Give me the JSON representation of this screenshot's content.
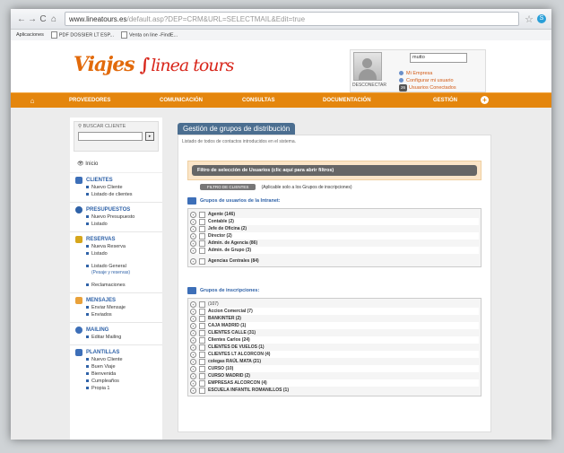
{
  "browser": {
    "url_main": "www.lineatours.es",
    "url_rest": "/default.asp?DEP=CRM&URL=SELECTMAIL&Edit=true",
    "bookmarks": [
      "Aplicaciones",
      "PDF DOSSIER LT ESP...",
      "Venta on line -FindE..."
    ]
  },
  "header": {
    "logo_first": "Viajes",
    "logo_second": "linea tours",
    "user_field": "mutto",
    "links": [
      "Mi Empresa",
      "Configurar mi usuario",
      "Usuarios Conectados"
    ],
    "connected_count": "26",
    "disconnect_label": "DESCONECTAR"
  },
  "menu": {
    "items": [
      "PROVEEDORES",
      "COMUNICACIÓN",
      "CONSULTAS",
      "DOCUMENTACIÓN",
      "GESTIÓN"
    ]
  },
  "sidebar": {
    "search_label": "BUSCAR CLIENTE",
    "inicio": "Inicio",
    "sections": [
      {
        "title": "CLIENTES",
        "color": "#3d6fb8",
        "items": [
          "Nuevo Cliente",
          "Listado de clientes"
        ]
      },
      {
        "title": "PRESUPUESTOS",
        "color": "#2f62a8",
        "items": [
          "Nuevo Presupuesto",
          "Listado"
        ]
      },
      {
        "title": "RESERVAS",
        "color": "#d6a61c",
        "items": [
          "Nueva Reserva",
          "Listado",
          "Listado General"
        ],
        "sub": "(Pesaje y reservas)",
        "extra": "Reclamaciones"
      },
      {
        "title": "MENSAJES",
        "color": "#e9a13a",
        "items": [
          "Enviar Mensaje",
          "Enviados"
        ]
      },
      {
        "title": "MAILING",
        "color": "#3d6fb8",
        "items": [
          "Editar Mailing"
        ]
      },
      {
        "title": "PLANTILLAS",
        "color": "#3d6fb8",
        "items": [
          "Nuevo Cliente",
          "Buen Viaje",
          "Bienvenida",
          "Cumpleaños",
          "Propia 1"
        ]
      }
    ]
  },
  "main": {
    "title": "Gestión de grupos de distribución",
    "description": "Listado de todos de contactos introducidos en el sistema.",
    "filter_bar": "Filtro de selección de Usuarios (clic aquí para abrir filtros)",
    "filter_button": "FILTRO DE CLIENTES",
    "filter_note": "(Aplicable solo a los Grupos de inscripciones)",
    "group1": {
      "title": "Grupos de usuarios de la Intranet:",
      "rows": [
        "Agente (146)",
        "Contable (2)",
        "Jefe de Oficina (2)",
        "Director (2)",
        "Admin. de Agencia (86)",
        "Admin. de Grupo (3)"
      ],
      "extra_row": "Agencias Centrales (84)"
    },
    "group2": {
      "title": "Grupos de inscripciones:",
      "rows": [
        "(107)",
        "Accion Comercial (7)",
        "BANKINTER (2)",
        "CAJA MADRID (1)",
        "CLIENTES CALLE (31)",
        "Clientes Carlos (24)",
        "CLIENTES DE VUELOS (1)",
        "CLIENTES LT ALCORCON (4)",
        "colegas RAÚL MATA (21)",
        "CURSO (10)",
        "CURSO MADRID (2)",
        "EMPRESAS ALCORCON (4)",
        "ESCUELA INFANTIL ROMANILLOS (1)"
      ]
    }
  }
}
